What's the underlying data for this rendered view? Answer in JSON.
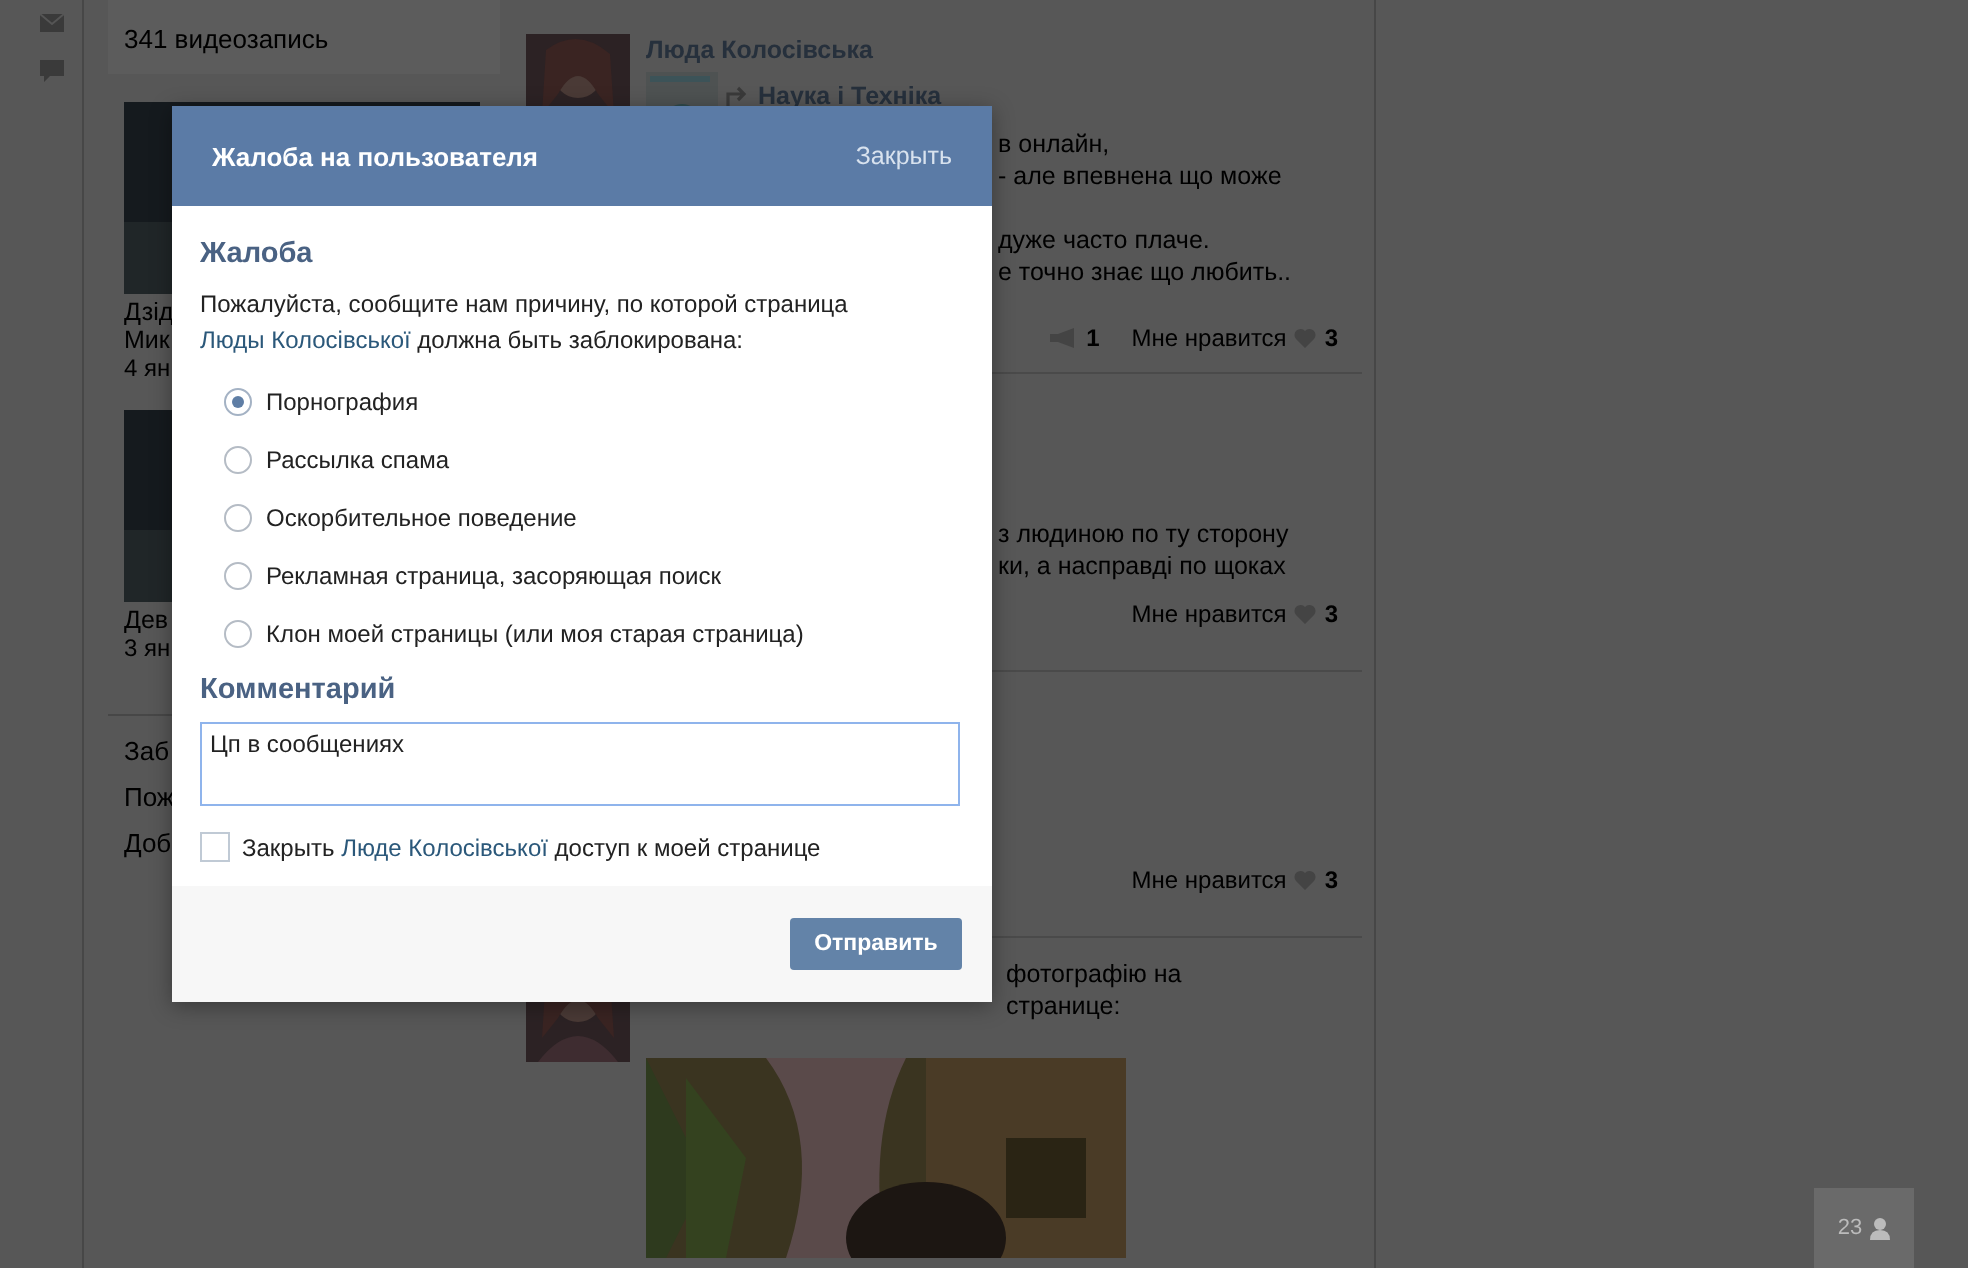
{
  "videos": {
    "count": "341 видеозапись",
    "items": [
      {
        "title_lines": [
          "Дзід",
          "Мик"
        ],
        "date": "4 ян"
      },
      {
        "title_lines": [
          "Дев"
        ],
        "date": "3 ян"
      }
    ]
  },
  "profile_links": [
    "Заб",
    "Пож",
    "Доб"
  ],
  "posts": [
    {
      "author": "Люда Колосівська",
      "source": "Наука і Техніка",
      "lines": [
        "в онлайн,",
        "- але впевнена що може",
        "дуже часто плаче.",
        "е точно знає що любить.."
      ],
      "reposts": "1",
      "like_label": "Мне нравится",
      "likes": "3"
    },
    {
      "lines": [
        "з людиною по ту сторону",
        "ки, а насправді по щоках"
      ],
      "like_label": "Мне нравится",
      "likes": "3"
    },
    {
      "like_label": "Мне нравится",
      "likes": "3"
    },
    {
      "lines": [
        "фотографію на",
        "странице:"
      ],
      "photo": {
        "kind": "picture"
      }
    }
  ],
  "online_count": "23",
  "dialog": {
    "title": "Жалоба на пользователя",
    "close": "Закрыть",
    "section": "Жалоба",
    "description": {
      "before": "Пожалуйста, сообщите нам причину, по которой страница",
      "link": "Люды Колосівської",
      "after": "должна быть заблокирована:"
    },
    "reasons": [
      {
        "label": "Порнография",
        "selected": true
      },
      {
        "label": "Рассылка спама",
        "selected": false
      },
      {
        "label": "Оскорбительное поведение",
        "selected": false
      },
      {
        "label": "Рекламная страница, засоряющая поиск",
        "selected": false
      },
      {
        "label": "Клон моей страницы (или моя старая страница)",
        "selected": false
      }
    ],
    "comment_heading": "Комментарий",
    "comment": "Цп в сообщениях",
    "block_access": {
      "checked": false,
      "before": "Закрыть",
      "link": "Люде Колосівської",
      "after": "доступ к моей странице"
    },
    "submit": "Отправить"
  }
}
